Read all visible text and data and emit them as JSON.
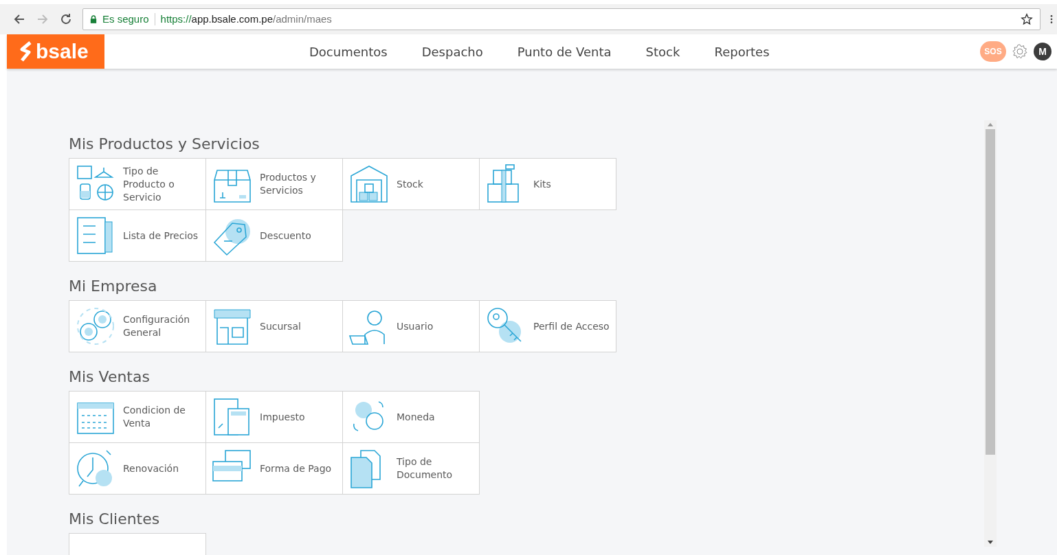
{
  "browser": {
    "security": "Es seguro",
    "url_scheme": "https://",
    "url_host": "app.bsale.com.pe",
    "url_path": "/admin/maes"
  },
  "header": {
    "logo": "bsale",
    "nav": [
      "Documentos",
      "Despacho",
      "Punto de Venta",
      "Stock",
      "Reportes"
    ],
    "sos": "SOS",
    "avatar": "M"
  },
  "sections": [
    {
      "title": "Mis Productos y Servicios",
      "rows": [
        [
          "Tipo de Producto o Servicio",
          "Productos y Servicios",
          "Stock",
          "Kits"
        ],
        [
          "Lista de Precios",
          "Descuento"
        ]
      ]
    },
    {
      "title": "Mi Empresa",
      "rows": [
        [
          "Configuración General",
          "Sucursal",
          "Usuario",
          "Perfil de Acceso"
        ]
      ]
    },
    {
      "title": "Mis Ventas",
      "rows": [
        [
          "Condicion de Venta",
          "Impuesto",
          "Moneda"
        ],
        [
          "Renovación",
          "Forma de Pago",
          "Tipo de Documento"
        ]
      ]
    },
    {
      "title": "Mis Clientes"
    }
  ]
}
